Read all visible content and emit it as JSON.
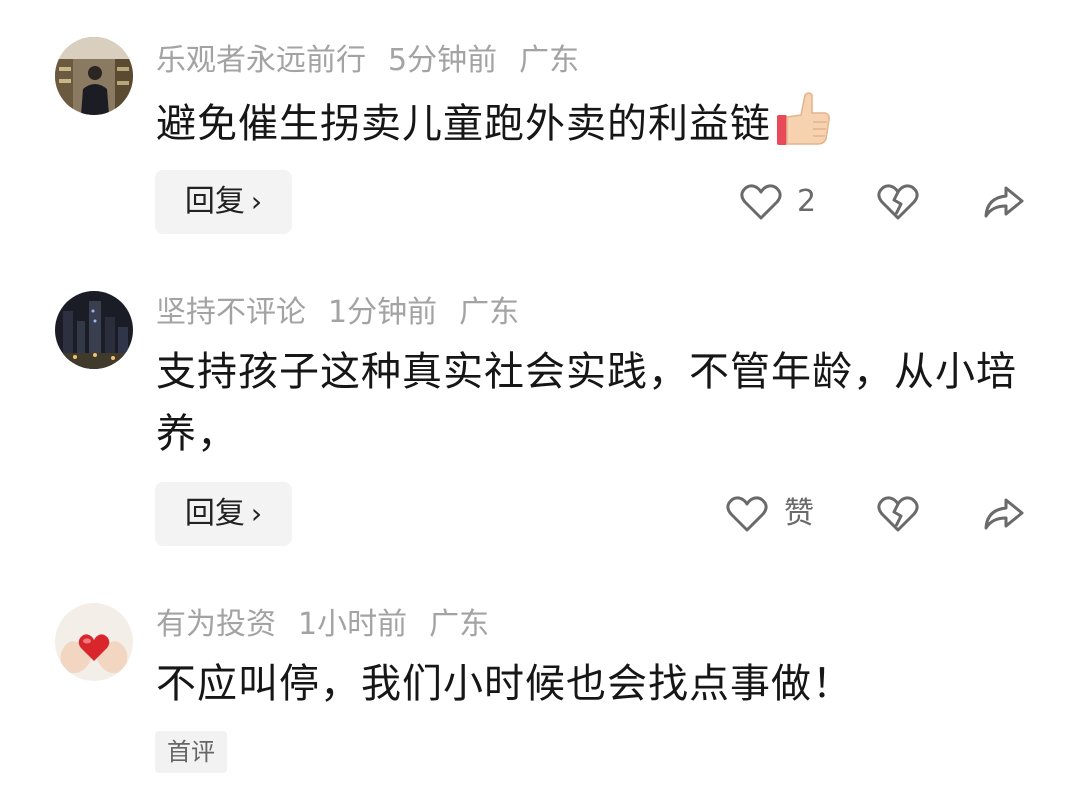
{
  "comments": [
    {
      "username": "乐观者永远前行",
      "time": "5分钟前",
      "location": "广东",
      "text": "避免催生拐卖儿童跑外卖的利益链",
      "emoji": "thumbs-up",
      "reply_label": "回复",
      "like_count": "2",
      "avatar": "person-in-store"
    },
    {
      "username": "坚持不评论",
      "time": "1分钟前",
      "location": "广东",
      "text": "支持孩子这种真实社会实践，不管年龄，从小培养，",
      "reply_label": "回复",
      "like_label": "赞",
      "avatar": "city-night"
    },
    {
      "username": "有为投资",
      "time": "1小时前",
      "location": "广东",
      "text": "不应叫停，我们小时候也会找点事做！",
      "tag": "首评",
      "avatar": "heart-in-hands"
    }
  ],
  "colors": {
    "meta": "#a3a3a3",
    "text": "#161616",
    "button_bg": "#f3f3f3",
    "icon": "#6a6a6a"
  }
}
